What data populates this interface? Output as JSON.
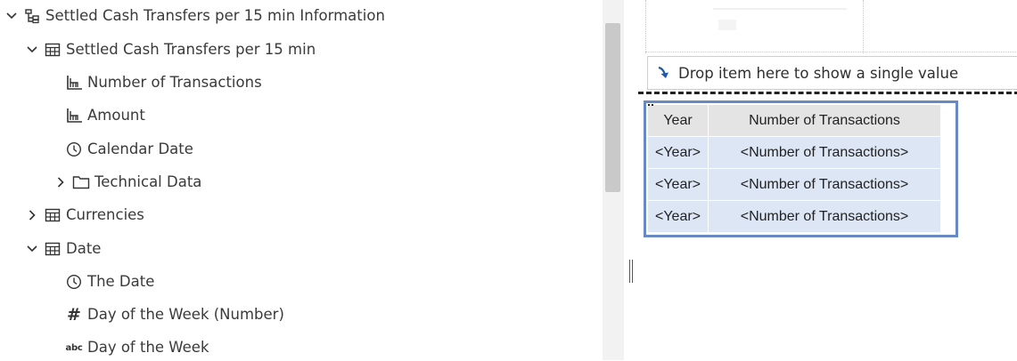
{
  "tree": {
    "root": {
      "label": "Settled Cash Transfers per 15 min Information",
      "icon": "hierarchy-icon",
      "expanded": true
    },
    "nodes": [
      {
        "label": "Settled Cash Transfers per 15 min",
        "icon": "table-icon",
        "expanded": true
      },
      {
        "label": "Number of Transactions",
        "icon": "measure-icon"
      },
      {
        "label": "Amount",
        "icon": "measure-icon"
      },
      {
        "label": "Calendar Date",
        "icon": "clock-icon"
      },
      {
        "label": "Technical Data",
        "icon": "folder-icon",
        "expanded": false
      },
      {
        "label": "Currencies",
        "icon": "table-icon",
        "expanded": false
      },
      {
        "label": "Date",
        "icon": "table-icon",
        "expanded": true
      },
      {
        "label": "The Date",
        "icon": "clock-icon"
      },
      {
        "label": "Day of the Week (Number)",
        "icon": "hash-icon",
        "glyph": "#"
      },
      {
        "label": "Day of the Week",
        "icon": "abc-icon",
        "glyph": "abc"
      }
    ]
  },
  "canvas": {
    "dropzone": {
      "text": "Drop item here to show a single value",
      "icon": "arrow-down-right-icon"
    },
    "list": {
      "headers": [
        "Year",
        "Number of Transactions"
      ],
      "rows": [
        [
          "<Year>",
          "<Number of Transactions>"
        ],
        [
          "<Year>",
          "<Number of Transactions>"
        ],
        [
          "<Year>",
          "<Number of Transactions>"
        ]
      ]
    }
  },
  "colors": {
    "selection_border": "#6889c2",
    "row_fill": "#dde6f5",
    "header_fill": "#e4e4e4",
    "arrow": "#1f5aa8"
  }
}
